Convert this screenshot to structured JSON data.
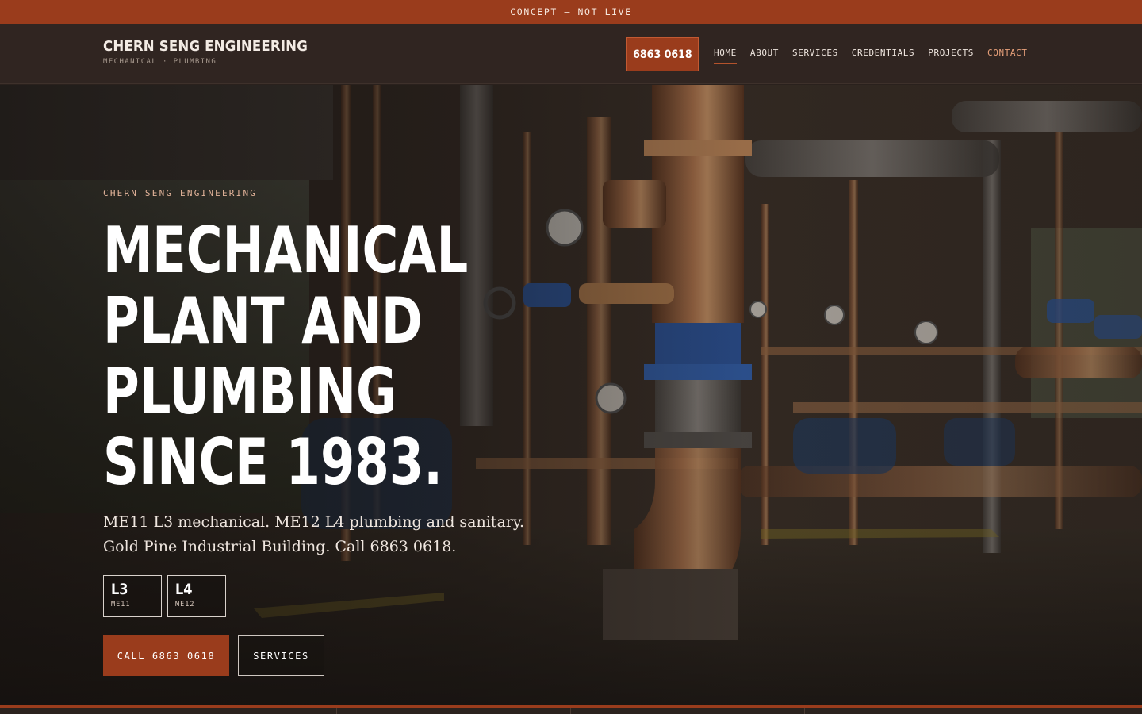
{
  "topbar": {
    "notice": "CONCEPT — NOT LIVE"
  },
  "header": {
    "brand_name": "CHERN SENG ENGINEERING",
    "brand_tagline": "MECHANICAL · PLUMBING",
    "phone_label": "6863 0618",
    "nav": [
      {
        "label": "HOME",
        "active": true
      },
      {
        "label": "ABOUT"
      },
      {
        "label": "SERVICES"
      },
      {
        "label": "CREDENTIALS"
      },
      {
        "label": "PROJECTS"
      },
      {
        "label": "CONTACT"
      }
    ]
  },
  "hero": {
    "eyebrow": "CHERN SENG ENGINEERING",
    "headline_lines": [
      "MECHANICAL",
      "PLANT AND",
      "PLUMBING",
      "SINCE 1983."
    ],
    "lead": "ME11 L3 mechanical. ME12 L4 plumbing and sanitary. Gold Pine Industrial Building. Call 6863 0618.",
    "badges": [
      {
        "grade": "L3",
        "code": "ME11"
      },
      {
        "grade": "L4",
        "code": "ME12"
      }
    ],
    "cta_primary": "CALL 6863 0618",
    "cta_secondary": "SERVICES"
  },
  "colors": {
    "accent": "#9a3c1c",
    "header_bg": "#302521",
    "contact_link": "#e7a07a"
  }
}
